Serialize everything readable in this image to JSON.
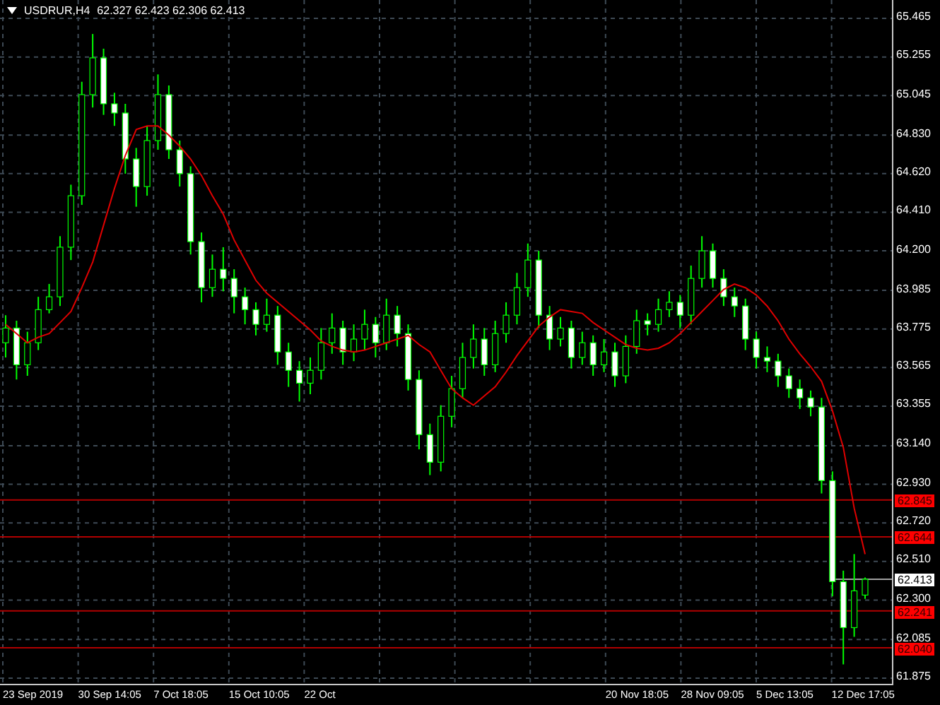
{
  "chart_header": {
    "symbol": "USDRUR,H4",
    "ohlc": "62.327 62.423 62.306 62.413"
  },
  "chart_data": {
    "type": "candlestick",
    "grid": true,
    "ylim": [
      61.875,
      65.465
    ],
    "yticks": [
      {
        "value": 65.465,
        "label": "65.465"
      },
      {
        "value": 65.255,
        "label": "65.255"
      },
      {
        "value": 65.045,
        "label": "65.045"
      },
      {
        "value": 64.83,
        "label": "64.830"
      },
      {
        "value": 64.62,
        "label": "64.620"
      },
      {
        "value": 64.41,
        "label": "64.410"
      },
      {
        "value": 64.2,
        "label": "64.200"
      },
      {
        "value": 63.985,
        "label": "63.985"
      },
      {
        "value": 63.775,
        "label": "63.775"
      },
      {
        "value": 63.565,
        "label": "63.565"
      },
      {
        "value": 63.355,
        "label": "63.355"
      },
      {
        "value": 63.14,
        "label": "63.140"
      },
      {
        "value": 62.93,
        "label": "62.930"
      },
      {
        "value": 62.72,
        "label": "62.720"
      },
      {
        "value": 62.51,
        "label": "62.510"
      },
      {
        "value": 62.3,
        "label": "62.300"
      },
      {
        "value": 62.085,
        "label": "62.085"
      },
      {
        "value": 61.875,
        "label": "61.875"
      }
    ],
    "ohlc": [
      [
        63.7,
        63.85,
        63.62,
        63.78
      ],
      [
        63.78,
        63.82,
        63.5,
        63.58
      ],
      [
        63.58,
        63.76,
        63.52,
        63.7
      ],
      [
        63.7,
        63.95,
        63.66,
        63.88
      ],
      [
        63.88,
        64.02,
        63.86,
        63.95
      ],
      [
        63.95,
        64.28,
        63.9,
        64.22
      ],
      [
        64.22,
        64.56,
        64.15,
        64.5
      ],
      [
        64.5,
        65.12,
        64.45,
        65.05
      ],
      [
        65.05,
        65.38,
        64.98,
        65.25
      ],
      [
        65.25,
        65.3,
        64.94,
        65.0
      ],
      [
        65.0,
        65.06,
        64.88,
        64.95
      ],
      [
        64.95,
        65.0,
        64.62,
        64.7
      ],
      [
        64.7,
        64.76,
        64.44,
        64.55
      ],
      [
        64.55,
        64.88,
        64.5,
        64.8
      ],
      [
        64.8,
        65.16,
        64.75,
        65.05
      ],
      [
        65.05,
        65.1,
        64.7,
        64.75
      ],
      [
        64.75,
        64.8,
        64.55,
        64.62
      ],
      [
        64.62,
        64.66,
        64.18,
        64.25
      ],
      [
        64.25,
        64.3,
        63.92,
        64.0
      ],
      [
        64.0,
        64.18,
        63.95,
        64.1
      ],
      [
        64.1,
        64.22,
        63.98,
        64.05
      ],
      [
        64.05,
        64.1,
        63.86,
        63.95
      ],
      [
        63.95,
        64.0,
        63.8,
        63.88
      ],
      [
        63.88,
        63.92,
        63.74,
        63.8
      ],
      [
        63.8,
        63.94,
        63.76,
        63.85
      ],
      [
        63.85,
        63.9,
        63.58,
        63.65
      ],
      [
        63.65,
        63.7,
        63.46,
        63.55
      ],
      [
        63.55,
        63.6,
        63.38,
        63.48
      ],
      [
        63.48,
        63.62,
        63.42,
        63.55
      ],
      [
        63.55,
        63.78,
        63.5,
        63.7
      ],
      [
        63.7,
        63.86,
        63.64,
        63.78
      ],
      [
        63.78,
        63.82,
        63.58,
        63.65
      ],
      [
        63.65,
        63.8,
        63.6,
        63.72
      ],
      [
        63.72,
        63.88,
        63.66,
        63.8
      ],
      [
        63.8,
        63.84,
        63.62,
        63.7
      ],
      [
        63.7,
        63.94,
        63.66,
        63.85
      ],
      [
        63.85,
        63.9,
        63.68,
        63.75
      ],
      [
        63.75,
        63.8,
        63.44,
        63.5
      ],
      [
        63.5,
        63.55,
        63.12,
        63.2
      ],
      [
        63.2,
        63.26,
        62.98,
        63.05
      ],
      [
        63.05,
        63.36,
        63.0,
        63.3
      ],
      [
        63.3,
        63.52,
        63.24,
        63.45
      ],
      [
        63.45,
        63.7,
        63.4,
        63.62
      ],
      [
        63.62,
        63.8,
        63.56,
        63.72
      ],
      [
        63.72,
        63.78,
        63.52,
        63.58
      ],
      [
        63.58,
        63.82,
        63.54,
        63.75
      ],
      [
        63.75,
        63.92,
        63.7,
        63.85
      ],
      [
        63.85,
        64.08,
        63.8,
        64.0
      ],
      [
        64.0,
        64.24,
        63.95,
        64.15
      ],
      [
        64.15,
        64.2,
        63.78,
        63.85
      ],
      [
        63.85,
        63.9,
        63.66,
        63.72
      ],
      [
        63.72,
        63.84,
        63.68,
        63.78
      ],
      [
        63.78,
        63.82,
        63.56,
        63.62
      ],
      [
        63.62,
        63.76,
        63.58,
        63.7
      ],
      [
        63.7,
        63.74,
        63.52,
        63.58
      ],
      [
        63.58,
        63.72,
        63.54,
        63.65
      ],
      [
        63.65,
        63.7,
        63.46,
        63.52
      ],
      [
        63.52,
        63.74,
        63.48,
        63.68
      ],
      [
        63.68,
        63.88,
        63.64,
        63.82
      ],
      [
        63.82,
        63.86,
        63.74,
        63.8
      ],
      [
        63.8,
        63.94,
        63.76,
        63.88
      ],
      [
        63.88,
        63.98,
        63.84,
        63.92
      ],
      [
        63.92,
        63.96,
        63.78,
        63.85
      ],
      [
        63.85,
        64.12,
        63.8,
        64.05
      ],
      [
        64.05,
        64.28,
        64.0,
        64.2
      ],
      [
        64.2,
        64.24,
        64.0,
        64.05
      ],
      [
        64.05,
        64.1,
        63.9,
        63.95
      ],
      [
        63.95,
        64.0,
        63.84,
        63.9
      ],
      [
        63.9,
        63.94,
        63.66,
        63.72
      ],
      [
        63.72,
        63.76,
        63.56,
        63.62
      ],
      [
        63.62,
        63.68,
        63.54,
        63.6
      ],
      [
        63.6,
        63.64,
        63.46,
        63.52
      ],
      [
        63.52,
        63.56,
        63.4,
        63.45
      ],
      [
        63.45,
        63.5,
        63.34,
        63.4
      ],
      [
        63.4,
        63.44,
        63.3,
        63.35
      ],
      [
        63.35,
        63.4,
        62.88,
        62.95
      ],
      [
        62.95,
        63.0,
        62.32,
        62.4
      ],
      [
        62.4,
        62.46,
        61.95,
        62.15
      ],
      [
        62.15,
        62.55,
        62.1,
        62.35
      ],
      [
        62.327,
        62.423,
        62.306,
        62.413
      ]
    ],
    "series": [
      {
        "type": "line",
        "color": "#e00000",
        "values": [
          63.8,
          63.75,
          63.7,
          63.73,
          63.75,
          63.81,
          63.87,
          64.0,
          64.14,
          64.34,
          64.54,
          64.72,
          64.86,
          64.88,
          64.88,
          64.83,
          64.77,
          64.7,
          64.61,
          64.5,
          64.4,
          64.26,
          64.15,
          64.04,
          63.97,
          63.92,
          63.87,
          63.82,
          63.77,
          63.71,
          63.68,
          63.66,
          63.65,
          63.66,
          63.68,
          63.7,
          63.72,
          63.74,
          63.69,
          63.65,
          63.55,
          63.45,
          63.4,
          63.36,
          63.41,
          63.46,
          63.54,
          63.63,
          63.71,
          63.79,
          63.84,
          63.88,
          63.87,
          63.86,
          63.81,
          63.77,
          63.73,
          63.69,
          63.67,
          63.66,
          63.67,
          63.7,
          63.75,
          63.81,
          63.87,
          63.93,
          63.99,
          64.02,
          64.0,
          63.96,
          63.9,
          63.82,
          63.72,
          63.64,
          63.57,
          63.49,
          63.33,
          63.13,
          62.8,
          62.55
        ]
      }
    ],
    "ref_lines": [
      {
        "axis": "y",
        "value": 62.845,
        "color": "#b00000",
        "label": "62.845"
      },
      {
        "axis": "y",
        "value": 62.644,
        "color": "#b00000",
        "label": "62.644"
      },
      {
        "axis": "y",
        "value": 62.241,
        "color": "#b00000",
        "label": "62.241"
      },
      {
        "axis": "y",
        "value": 62.04,
        "color": "#b00000",
        "label": "62.040"
      }
    ]
  },
  "current_price": {
    "label": "62.413"
  },
  "time_axis": {
    "labels": [
      "23 Sep 2019",
      "30 Sep 14:05",
      "7 Oct 18:05",
      "15 Oct 10:05",
      "22 Oct",
      "20 Nov 18:05",
      "28 Nov 09:05",
      "5 Dec 13:05",
      "12 Dec 17:05"
    ]
  }
}
